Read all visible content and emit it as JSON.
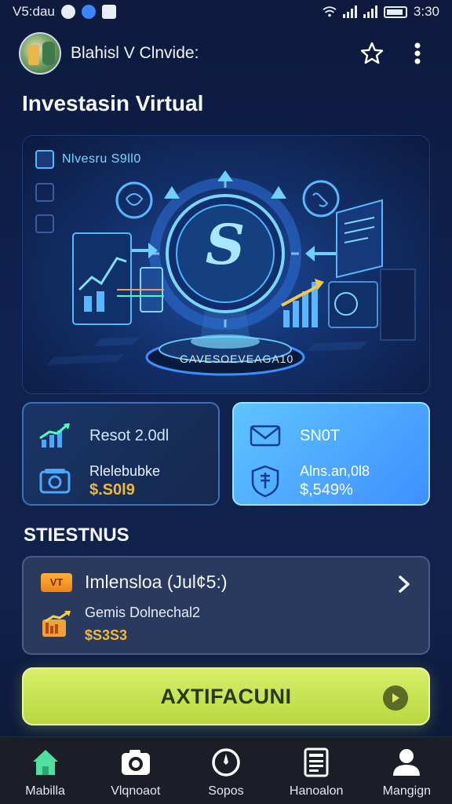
{
  "status_bar": {
    "time": "V5:dau",
    "clock": "3:30"
  },
  "header": {
    "name": "Blahisl V Clnvide:",
    "icons": [
      "avatar",
      "star-icon",
      "more-vert-icon"
    ]
  },
  "page": {
    "title": "Investasin Virtual"
  },
  "hero": {
    "badge_text": "Nlvesru S9ll0",
    "caption": "GAVESOEVEAGA10",
    "center_symbol": "S"
  },
  "stats": [
    {
      "title": "Resot 2.0dl",
      "label": "Rlelebubke",
      "value": "$.S0l9",
      "icon_top": "chart-up-icon",
      "icon_bottom": "wallet-icon"
    },
    {
      "title": "SN0T",
      "label": "Alns.an,0l8",
      "value": "$,549%",
      "icon_top": "mail-icon",
      "icon_bottom": "shield-icon"
    }
  ],
  "section": {
    "title": "STIESTNUS"
  },
  "investment": {
    "tag": "VT",
    "name": "Imlensloa (Jul¢5:)",
    "subtitle": "Gemis Dolnechal2",
    "amount": "$S3S3"
  },
  "action": {
    "label": "AXTIFACUNI"
  },
  "nav": [
    {
      "label": "Mabilla",
      "icon": "home-icon"
    },
    {
      "label": "Vlqnoaot",
      "icon": "camera-icon"
    },
    {
      "label": "Sopos",
      "icon": "compass-icon"
    },
    {
      "label": "Hanoalon",
      "icon": "document-icon"
    },
    {
      "label": "Mangign",
      "icon": "person-icon"
    }
  ],
  "colors": {
    "background": "#0f2150",
    "accent": "#58b8ff",
    "gold": "#f2b83a",
    "action": "#c8e44f",
    "nav_active": "#4fe0a0"
  }
}
